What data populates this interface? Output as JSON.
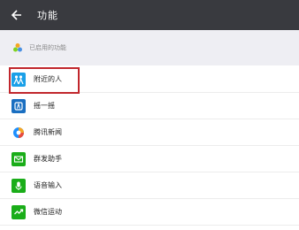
{
  "header": {
    "title": "功能",
    "background": "#393a3f"
  },
  "section": {
    "label": "已启用的功能"
  },
  "items": [
    {
      "label": "附近的人",
      "icon": "people-nearby-icon",
      "color": "#1aa0e8"
    },
    {
      "label": "摇一摇",
      "icon": "shake-icon",
      "color": "#1a6fc1"
    },
    {
      "label": "腾讯新闻",
      "icon": "tencent-news-icon",
      "color": "#1aad19"
    },
    {
      "label": "群发助手",
      "icon": "mass-send-icon",
      "color": "#1aad19"
    },
    {
      "label": "语音输入",
      "icon": "voice-input-icon",
      "color": "#1aad19"
    },
    {
      "label": "微信运动",
      "icon": "wechat-sport-icon",
      "color": "#1aad19"
    }
  ],
  "highlight": {
    "color": "#c1272d"
  }
}
